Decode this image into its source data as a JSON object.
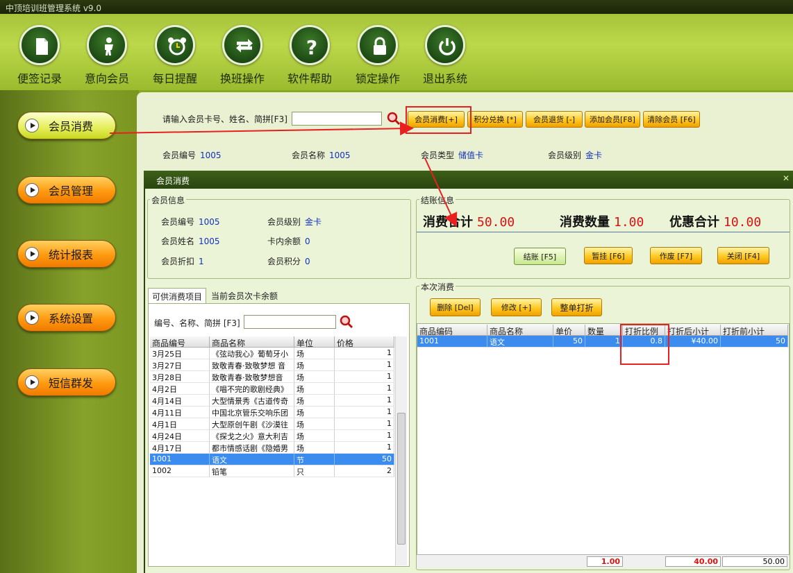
{
  "app": {
    "title": "中顶培训班管理系统 v9.0"
  },
  "toolbar": {
    "items": [
      {
        "label": "便签记录",
        "icon": "note-icon"
      },
      {
        "label": "意向会员",
        "icon": "person-icon"
      },
      {
        "label": "每日提醒",
        "icon": "alarm-clock-icon"
      },
      {
        "label": "换班操作",
        "icon": "swap-arrows-icon"
      },
      {
        "label": "软件帮助",
        "icon": "help-icon"
      },
      {
        "label": "锁定操作",
        "icon": "lock-icon"
      },
      {
        "label": "退出系统",
        "icon": "power-icon"
      }
    ]
  },
  "sidebar": {
    "items": [
      {
        "label": "会员消费",
        "active": true
      },
      {
        "label": "会员管理"
      },
      {
        "label": "统计报表"
      },
      {
        "label": "系统设置"
      },
      {
        "label": "短信群发"
      }
    ]
  },
  "search": {
    "label": "请输入会员卡号、姓名、简拼[F3]",
    "value": ""
  },
  "actions": {
    "consume": "会员消费[+]",
    "points": "积分兑换 [*]",
    "return": "会员退货 [-]",
    "add": "添加会员[F8]",
    "clear": "清除会员 [F6]"
  },
  "member_bar": {
    "id_label": "会员编号",
    "id_value": "1005",
    "name_label": "会员名称",
    "name_value": "1005",
    "type_label": "会员类型",
    "type_value": "储值卡",
    "level_label": "会员级别",
    "level_value": "金卡"
  },
  "dialog": {
    "title": "会员消费",
    "member_info": {
      "group_title": "会员信息",
      "id_label": "会员编号",
      "id_value": "1005",
      "level_label": "会员级别",
      "level_value": "金卡",
      "name_label": "会员姓名",
      "name_value": "1005",
      "balance_label": "卡内余额",
      "balance_value": "0",
      "discount_label": "会员折扣",
      "discount_value": "1",
      "points_label": "会员积分",
      "points_value": "0"
    },
    "checkout": {
      "group_title": "结账信息",
      "total_label": "消费合计",
      "total_value": "50.00",
      "qty_label": "消费数量",
      "qty_value": "1.00",
      "discount_label": "优惠合计",
      "discount_value": "10.00",
      "settle_btn": "结账 [F5]",
      "hold_btn": "暂挂 [F6]",
      "void_btn": "作废 [F7]",
      "close_btn": "关闭 [F4]"
    },
    "tabs": [
      "可供消费项目",
      "当前会员次卡余额"
    ],
    "item_search": {
      "label": "编号、名称、简拼 [F3]",
      "value": ""
    },
    "items_table": {
      "headers": [
        "商品编号",
        "商品名称",
        "单位",
        "价格"
      ],
      "rows": [
        [
          "3月25日",
          "《弦动我心》葡萄牙小",
          "场",
          "1"
        ],
        [
          "3月27日",
          "致敬青春·致敬梦想 音",
          "场",
          "1"
        ],
        [
          "3月28日",
          "致敬青春·致敬梦想音",
          "场",
          "1"
        ],
        [
          "4月2日",
          "《唱不完的歌剧经典》",
          "场",
          "1"
        ],
        [
          "4月14日",
          "大型情景秀《古道传奇",
          "场",
          "1"
        ],
        [
          "4月11日",
          "中国北京管乐交响乐团",
          "场",
          "1"
        ],
        [
          "4月1日",
          "大型原创午剧《沙漠往",
          "场",
          "1"
        ],
        [
          "4月24日",
          "《探戈之火》意大利吉",
          "场",
          "1"
        ],
        [
          "4月17日",
          "都市情感话剧《隐婚男",
          "场",
          "1"
        ],
        [
          "1001",
          "语文",
          "节",
          "50"
        ],
        [
          "1002",
          "铅笔",
          "只",
          "2"
        ]
      ],
      "selected_row": 9
    },
    "current": {
      "group_title": "本次消费",
      "delete_btn": "删除 [Del]",
      "edit_btn": "修改 [+]",
      "whole_discount_btn": "整单打折",
      "headers": [
        "商品编码",
        "商品名称",
        "单价",
        "数量",
        "打折比例",
        "打折后小计",
        "打折前小计"
      ],
      "rows": [
        [
          "1001",
          "语文",
          "50",
          "1",
          "0.8",
          "¥40.00",
          "50"
        ]
      ],
      "sum_qty": "1.00",
      "sum_after": "40.00",
      "sum_before": "50.00"
    }
  },
  "colors": {
    "accent": "#ff9a10",
    "annotation": "#e82020",
    "selection": "#3c8cf0"
  }
}
